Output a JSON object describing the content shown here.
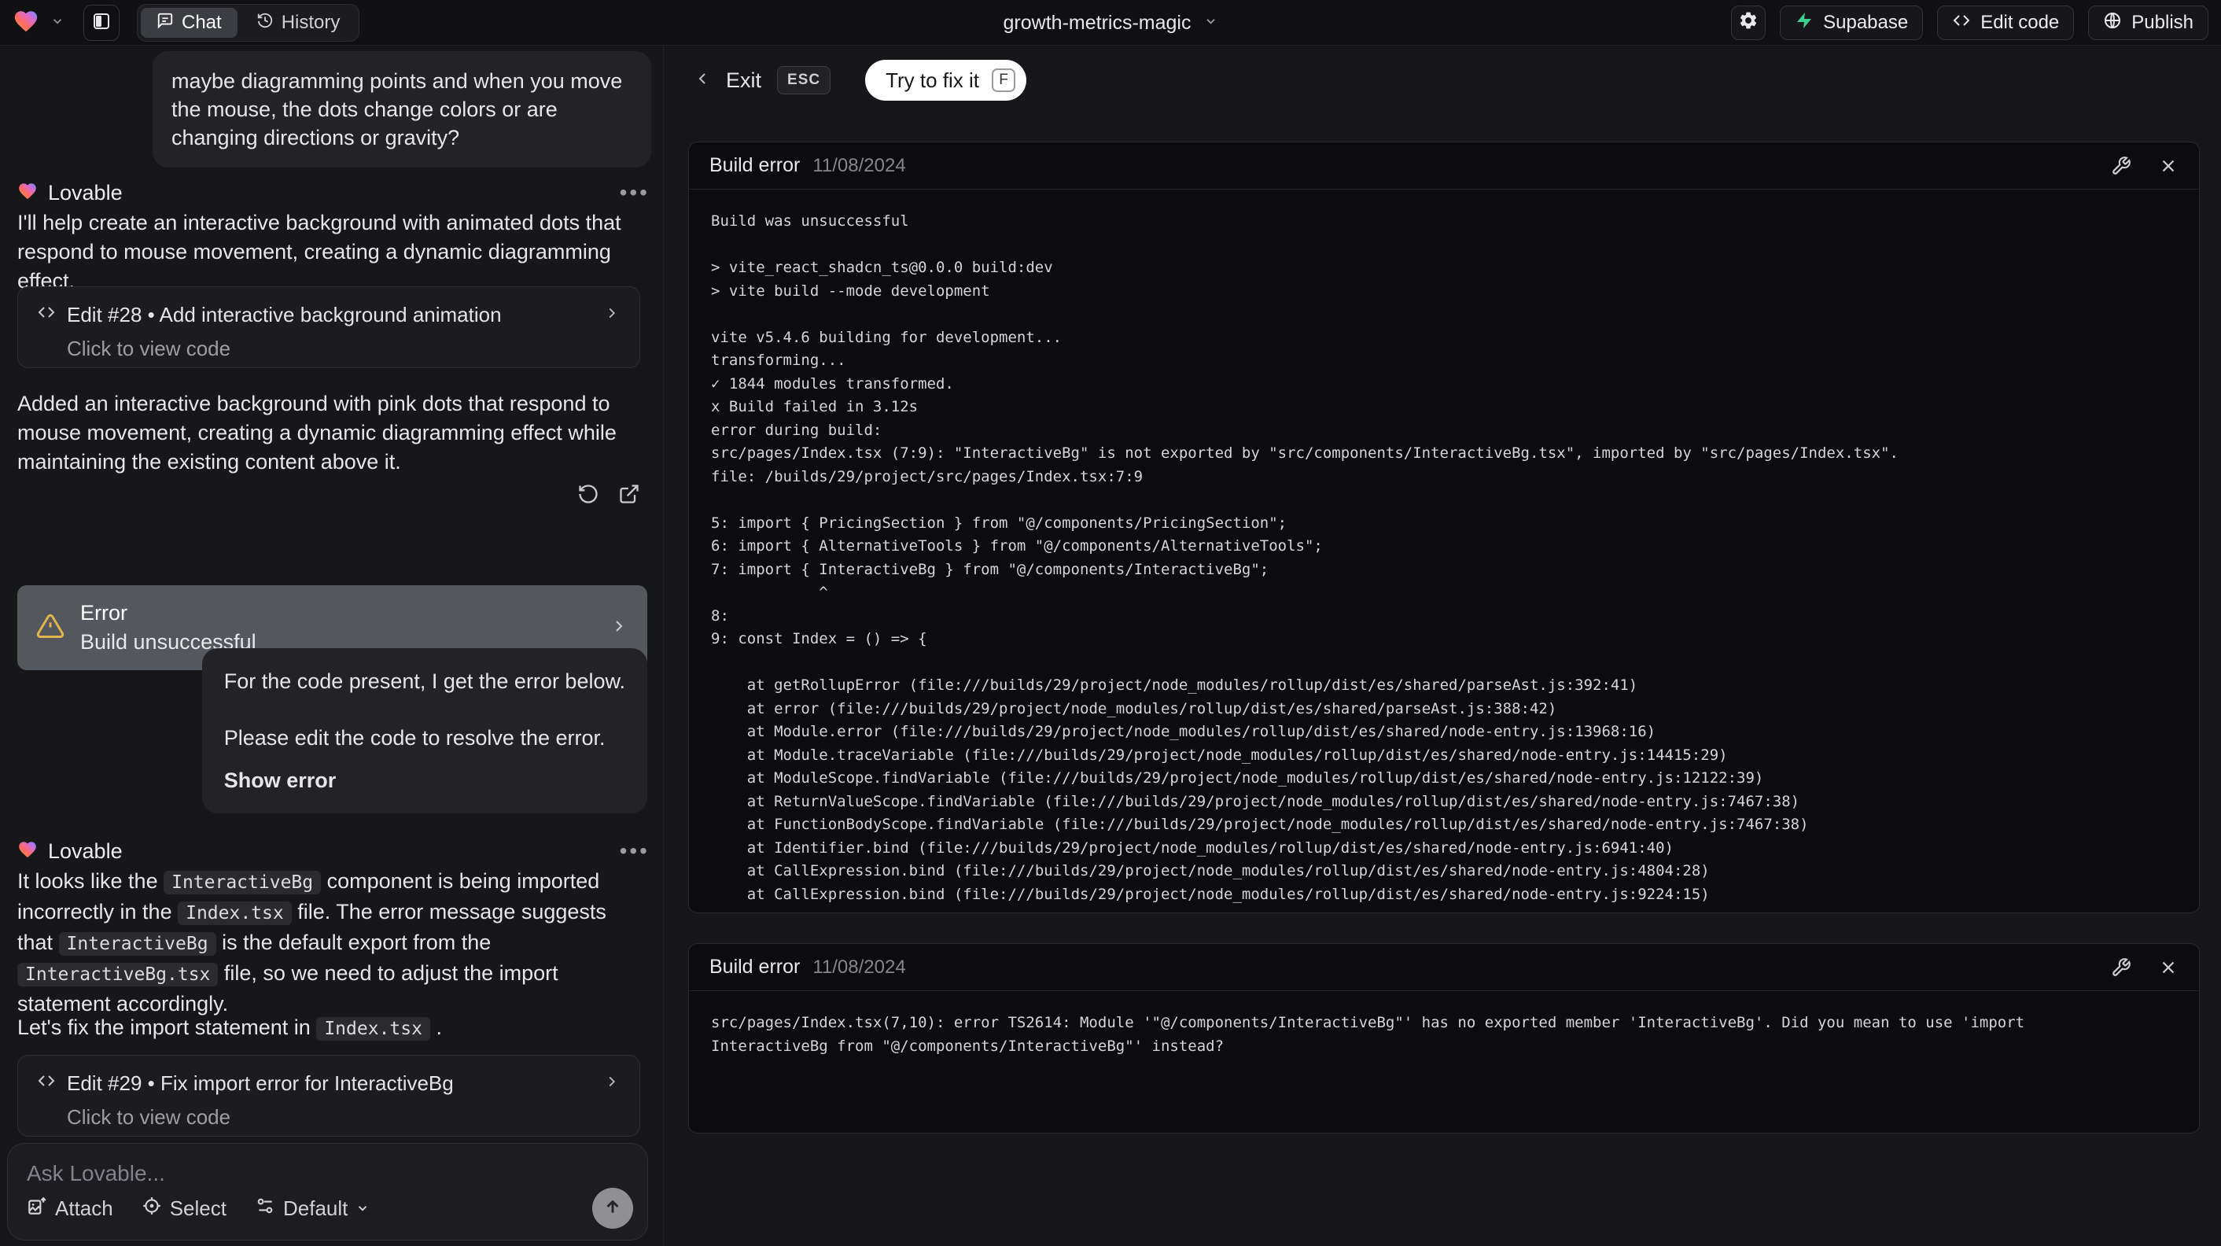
{
  "colors": {
    "supabase_green": "#3ecf8e",
    "warning_amber": "#e2b44c",
    "fix_pill_bg": "#ffffff"
  },
  "header": {
    "tabs": {
      "chat": "Chat",
      "history": "History"
    },
    "project_name": "growth-metrics-magic",
    "supabase_label": "Supabase",
    "edit_code_label": "Edit code",
    "publish_label": "Publish"
  },
  "chat": {
    "assistant_name": "Lovable",
    "user_message_1": "maybe diagramming points and when you move the mouse, the dots change colors or are changing directions or gravity?",
    "assistant_message_1": "I'll help create an interactive background with animated dots that respond to mouse movement, creating a dynamic diagramming effect.",
    "edit_card_1": {
      "title": "Edit #28 • Add interactive background animation",
      "subtitle": "Click to view code"
    },
    "assistant_message_2": "Added an interactive background with pink dots that respond to mouse movement, creating a dynamic diagramming effect while maintaining the existing content above it.",
    "error_card": {
      "title": "Error",
      "subtitle": "Build unsuccessful"
    },
    "user_message_2_body": "For the code present, I get the error below.\n\nPlease edit the code to resolve the error.",
    "user_message_2_action": "Show error",
    "assistant_message_3_rich": [
      {
        "t": "text",
        "v": "It looks like the "
      },
      {
        "t": "code",
        "v": "InteractiveBg"
      },
      {
        "t": "text",
        "v": " component is being imported incorrectly in the "
      },
      {
        "t": "code",
        "v": "Index.tsx"
      },
      {
        "t": "text",
        "v": " file. The error message suggests that "
      },
      {
        "t": "code",
        "v": "InteractiveBg"
      },
      {
        "t": "text",
        "v": " is the default export from the "
      },
      {
        "t": "code",
        "v": "InteractiveBg.tsx"
      },
      {
        "t": "text",
        "v": " file, so we need to adjust the import statement accordingly."
      }
    ],
    "assistant_message_4_rich": [
      {
        "t": "text",
        "v": "Let's fix the import statement in "
      },
      {
        "t": "code",
        "v": "Index.tsx"
      },
      {
        "t": "text",
        "v": " ."
      }
    ],
    "edit_card_2": {
      "title": "Edit #29 • Fix import error for InteractiveBg",
      "subtitle": "Click to view code"
    },
    "input": {
      "placeholder": "Ask Lovable...",
      "attach_label": "Attach",
      "select_label": "Select",
      "mode_label": "Default"
    }
  },
  "error_view": {
    "exit_label": "Exit",
    "esc_key": "ESC",
    "fix_button_label": "Try to fix it",
    "fix_key": "F",
    "panel_1": {
      "title": "Build error",
      "date": "11/08/2024",
      "log": "Build was unsuccessful\n\n> vite_react_shadcn_ts@0.0.0 build:dev\n> vite build --mode development\n\nvite v5.4.6 building for development...\ntransforming...\n✓ 1844 modules transformed.\nx Build failed in 3.12s\nerror during build:\nsrc/pages/Index.tsx (7:9): \"InteractiveBg\" is not exported by \"src/components/InteractiveBg.tsx\", imported by \"src/pages/Index.tsx\".\nfile: /builds/29/project/src/pages/Index.tsx:7:9\n\n5: import { PricingSection } from \"@/components/PricingSection\";\n6: import { AlternativeTools } from \"@/components/AlternativeTools\";\n7: import { InteractiveBg } from \"@/components/InteractiveBg\";\n            ^\n8: \n9: const Index = () => {\n\n    at getRollupError (file:///builds/29/project/node_modules/rollup/dist/es/shared/parseAst.js:392:41)\n    at error (file:///builds/29/project/node_modules/rollup/dist/es/shared/parseAst.js:388:42)\n    at Module.error (file:///builds/29/project/node_modules/rollup/dist/es/shared/node-entry.js:13968:16)\n    at Module.traceVariable (file:///builds/29/project/node_modules/rollup/dist/es/shared/node-entry.js:14415:29)\n    at ModuleScope.findVariable (file:///builds/29/project/node_modules/rollup/dist/es/shared/node-entry.js:12122:39)\n    at ReturnValueScope.findVariable (file:///builds/29/project/node_modules/rollup/dist/es/shared/node-entry.js:7467:38)\n    at FunctionBodyScope.findVariable (file:///builds/29/project/node_modules/rollup/dist/es/shared/node-entry.js:7467:38)\n    at Identifier.bind (file:///builds/29/project/node_modules/rollup/dist/es/shared/node-entry.js:6941:40)\n    at CallExpression.bind (file:///builds/29/project/node_modules/rollup/dist/es/shared/node-entry.js:4804:28)\n    at CallExpression.bind (file:///builds/29/project/node_modules/rollup/dist/es/shared/node-entry.js:9224:15)"
    },
    "panel_2": {
      "title": "Build error",
      "date": "11/08/2024",
      "log": "src/pages/Index.tsx(7,10): error TS2614: Module '\"@/components/InteractiveBg\"' has no exported member 'InteractiveBg'. Did you mean to use 'import\nInteractiveBg from \"@/components/InteractiveBg\"' instead?"
    }
  }
}
